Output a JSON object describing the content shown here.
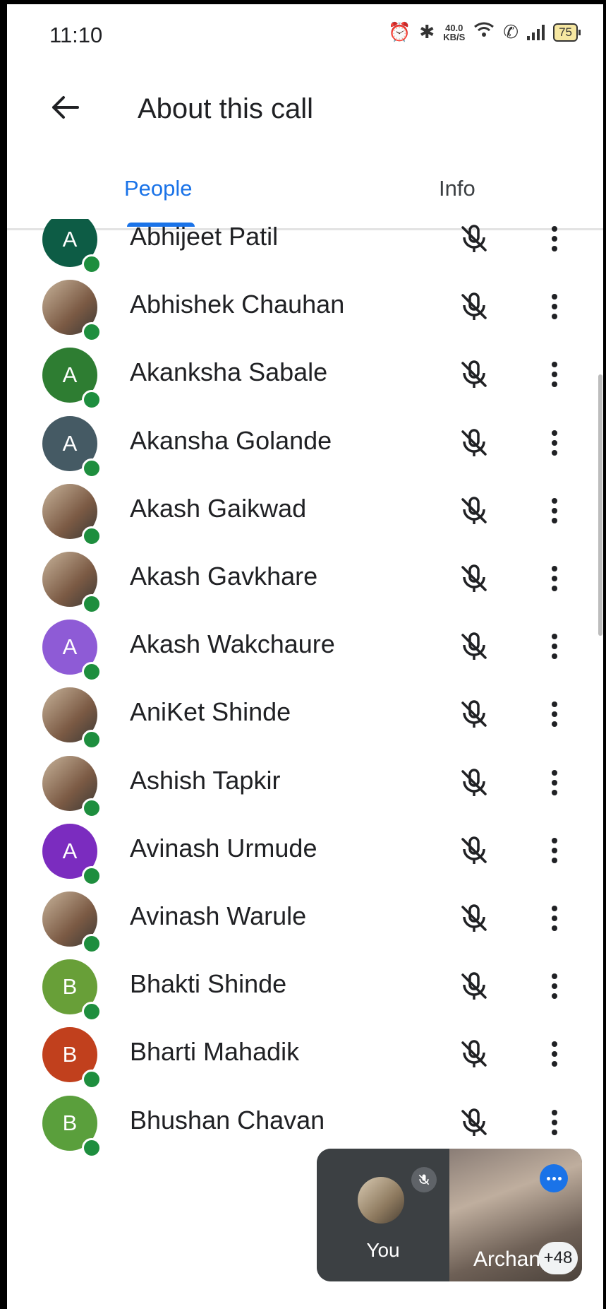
{
  "status_bar": {
    "time": "11:10",
    "net_speed_value": "40.0",
    "net_speed_unit": "KB/S",
    "battery": "75"
  },
  "app_bar": {
    "title": "About this call"
  },
  "tabs": [
    {
      "label": "People",
      "selected": true
    },
    {
      "label": "Info",
      "selected": false
    }
  ],
  "participants": [
    {
      "name": "Abhijeet Patil",
      "initial": "A",
      "avatar_color": "#0d5c45",
      "photo": false
    },
    {
      "name": "Abhishek Chauhan",
      "initial": "",
      "avatar_color": "#9a7b66",
      "photo": true
    },
    {
      "name": "Akanksha Sabale",
      "initial": "A",
      "avatar_color": "#2e7d32",
      "photo": false
    },
    {
      "name": "Akansha Golande",
      "initial": "A",
      "avatar_color": "#455a64",
      "photo": false
    },
    {
      "name": "Akash Gaikwad",
      "initial": "",
      "avatar_color": "#8a6d4f",
      "photo": true
    },
    {
      "name": "Akash Gavkhare",
      "initial": "",
      "avatar_color": "#5d5246",
      "photo": true
    },
    {
      "name": "Akash Wakchaure",
      "initial": "A",
      "avatar_color": "#8e5bd6",
      "photo": false
    },
    {
      "name": "AniKet Shinde",
      "initial": "",
      "avatar_color": "#a58c6c",
      "photo": true
    },
    {
      "name": "Ashish Tapkir",
      "initial": "",
      "avatar_color": "#b29d88",
      "photo": true
    },
    {
      "name": "Avinash Urmude",
      "initial": "A",
      "avatar_color": "#7b2cbf",
      "photo": false
    },
    {
      "name": "Avinash Warule",
      "initial": "",
      "avatar_color": "#3c3330",
      "photo": true
    },
    {
      "name": "Bhakti Shinde",
      "initial": "B",
      "avatar_color": "#689f38",
      "photo": false
    },
    {
      "name": "Bharti Mahadik",
      "initial": "B",
      "avatar_color": "#c1401d",
      "photo": false
    },
    {
      "name": "Bhushan Chavan",
      "initial": "B",
      "avatar_color": "#5a9f3c",
      "photo": false
    }
  ],
  "pip": {
    "self_label": "You",
    "remote_name": "Archan",
    "more_count": "+48"
  },
  "colors": {
    "accent": "#1a73e8",
    "presence": "#1e8e3e"
  }
}
